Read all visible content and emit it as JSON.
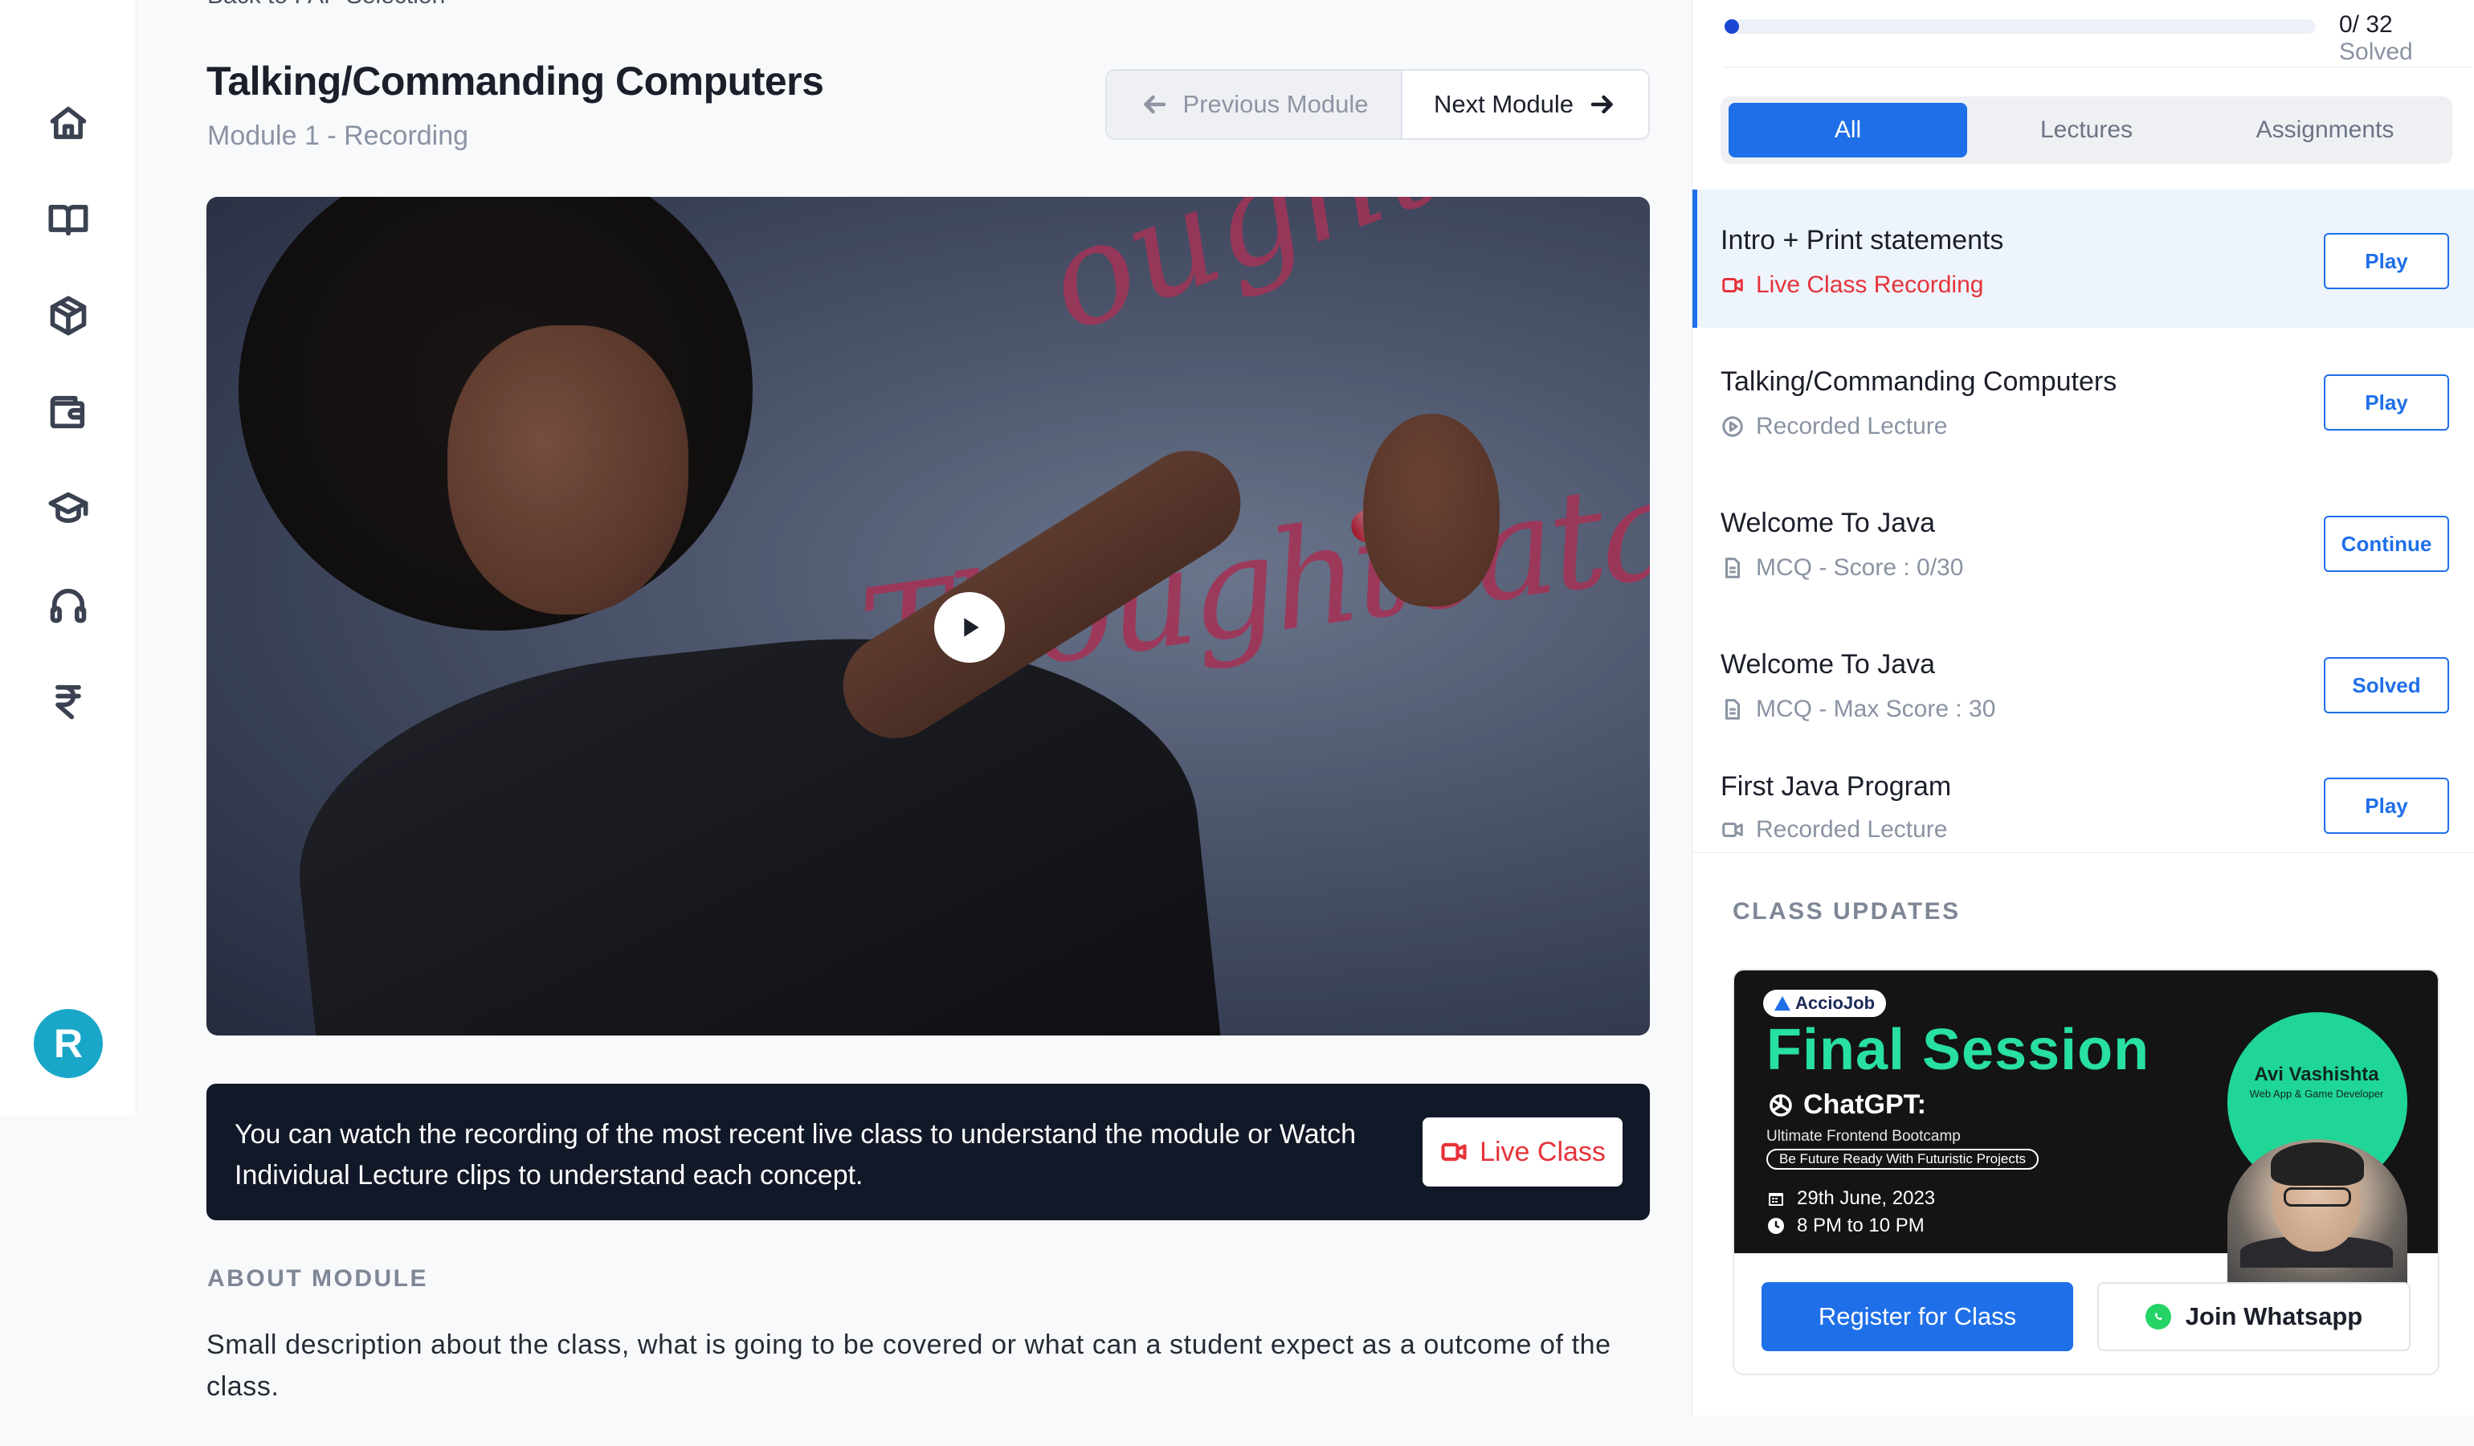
{
  "header": {
    "breadcrumb": "Back to FAP Selection",
    "title": "Talking/Commanding Computers",
    "subtitle": "Module 1 - Recording",
    "prev_label": "Previous Module",
    "next_label": "Next Module"
  },
  "sidebar": {
    "icons": [
      "home-icon",
      "book-icon",
      "cube-icon",
      "wallet-icon",
      "graduation-cap-icon",
      "headphones-icon",
      "rupee-icon"
    ],
    "avatar_letter": "R",
    "avatar_color": "#1aa6c9"
  },
  "notice": {
    "text": "You can watch the recording of the most recent live class to understand the module or Watch Individual Lecture clips to understand each concept.",
    "button_label": "Live Class"
  },
  "about": {
    "label": "ABOUT MODULE",
    "text": "Small description about the class, what is going to be covered or what can a student expect as a outcome of the class."
  },
  "progress": {
    "count": "0/ 32",
    "label": "Solved",
    "fraction": 0.0
  },
  "filters": {
    "all": "All",
    "lectures": "Lectures",
    "assignments": "Assignments",
    "active": "All"
  },
  "items": [
    {
      "title": "Intro + Print statements",
      "meta": "Live Class Recording",
      "icon": "video-icon",
      "button": "Play",
      "active": true
    },
    {
      "title": "Talking/Commanding Computers",
      "meta": "Recorded Lecture",
      "icon": "play-circle-icon",
      "button": "Play",
      "active": false
    },
    {
      "title": "Welcome To Java",
      "meta": "MCQ  -  Score : 0/30",
      "icon": "document-icon",
      "button": "Continue",
      "active": false
    },
    {
      "title": "Welcome To Java",
      "meta": "MCQ  -  Max Score : 30",
      "icon": "document-icon",
      "button": "Solved",
      "active": false
    },
    {
      "title": "First Java Program",
      "meta": "Recorded Lecture",
      "icon": "video-icon",
      "button": "Play",
      "active": false
    }
  ],
  "updates": {
    "label": "CLASS UPDATES",
    "banner": {
      "brand": "AccioJob",
      "title": "Final Session",
      "topic": "ChatGPT:",
      "sub": "Ultimate Frontend Bootcamp",
      "pill": "Be Future Ready With Futuristic Projects",
      "date": "29th June, 2023",
      "time": "8 PM to 10 PM",
      "speaker": "Avi Vashishta",
      "speaker_role": "Web App & Game Developer"
    },
    "register_label": "Register for Class",
    "whatsapp_label": "Join Whatsapp"
  },
  "colors": {
    "accent": "#1f6fe8",
    "live_red": "#e5333a",
    "banner_green": "#28e0a0",
    "notice_bg": "#111827"
  }
}
